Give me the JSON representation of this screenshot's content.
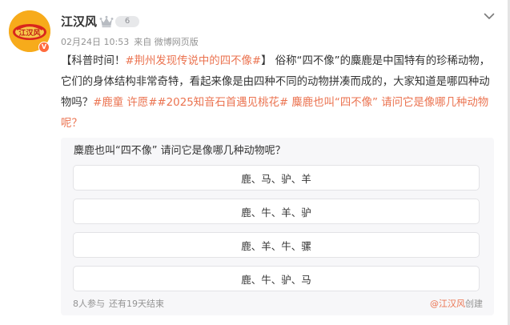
{
  "post": {
    "author": "江汉风",
    "member_level": "6",
    "avatar_text": "江汉风",
    "date": "02月24日 10:53",
    "source": "来自 微博网页版",
    "content": {
      "part1": "【科普时间！",
      "tag1": "#荆州发现传说中的四不像#",
      "part2": "】 俗称“四不像”的麋鹿是中国特有的珍稀动物，它们的身体结构非常奇特，看起来像是由四种不同的动物拼凑而成的，大家知道是哪四种动物吗？",
      "tag2": "#鹿童 许愿##2025知音石首遇见桃花#",
      "tag3": " 麋鹿也叫“四不像” 请问它是像哪几种动物呢？"
    }
  },
  "poll": {
    "question": "麋鹿也叫“四不像” 请问它是像哪几种动物呢？",
    "options": [
      "鹿、马、驴、羊",
      "鹿、牛、羊、驴",
      "鹿、羊、牛、骡",
      "鹿、牛、驴、马"
    ],
    "participants": "8人参与",
    "remaining": "还有19天结束",
    "creator": "@江汉风",
    "created_label": "创建"
  },
  "colors": {
    "link": "#eb7350",
    "avatar_bg": "#f7ab1b",
    "poll_bg": "#f7f7f9",
    "muted": "#939393"
  },
  "icons": [
    "crown-icon",
    "verified-icon",
    "chevron-down-icon"
  ]
}
